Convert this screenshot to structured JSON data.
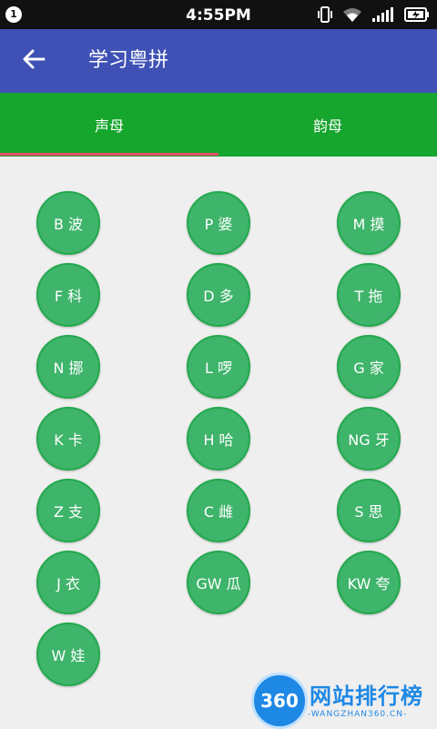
{
  "status_bar": {
    "notification_count": "1",
    "time": "4:55PM",
    "icons": [
      "vibrate-icon",
      "wifi-icon",
      "signal-icon",
      "battery-charging-icon"
    ]
  },
  "app_bar": {
    "title": "学习粤拼",
    "back_icon": "arrow-left-icon",
    "color": "#3f51b5"
  },
  "tabs": [
    {
      "label": "声母",
      "selected": true
    },
    {
      "label": "韵母",
      "selected": false
    }
  ],
  "colors": {
    "tab_bar": "#16a52d",
    "tab_indicator": "#e94e6a",
    "key_fill": "#3fb46b",
    "key_border": "#23a94d"
  },
  "initials": [
    {
      "label": "B 波"
    },
    {
      "label": "P 婆"
    },
    {
      "label": "M 摸"
    },
    {
      "label": "F 科"
    },
    {
      "label": "D 多"
    },
    {
      "label": "T 拖"
    },
    {
      "label": "N 挪"
    },
    {
      "label": "L 啰"
    },
    {
      "label": "G 家"
    },
    {
      "label": "K 卡"
    },
    {
      "label": "H 哈"
    },
    {
      "label": "NG 牙"
    },
    {
      "label": "Z 支"
    },
    {
      "label": "C 雌"
    },
    {
      "label": "S 思"
    },
    {
      "label": "J 衣"
    },
    {
      "label": "GW 瓜"
    },
    {
      "label": "KW 夸"
    },
    {
      "label": "W 娃"
    }
  ],
  "watermark": {
    "logo_text": "360",
    "name": "网站排行榜",
    "url": "-WANGZHAN360.CN-"
  }
}
